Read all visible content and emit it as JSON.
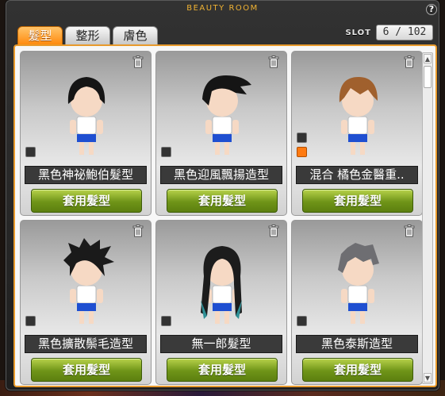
{
  "window": {
    "title": "BEAUTY ROOM",
    "help_label": "?"
  },
  "tabs": [
    {
      "label": "髮型",
      "active": true
    },
    {
      "label": "整形",
      "active": false
    },
    {
      "label": "膚色",
      "active": false
    }
  ],
  "slot": {
    "label": "SLOT",
    "value": "6 / 102"
  },
  "items": [
    {
      "name": "黑色神祕鮑伯髮型",
      "button": "套用髮型",
      "hair_color": "#151515",
      "style": "bob",
      "swatches": [
        "dark"
      ]
    },
    {
      "name": "黑色迎風飄揚造型",
      "button": "套用髮型",
      "hair_color": "#151515",
      "style": "wind",
      "swatches": [
        "dark"
      ]
    },
    {
      "name": "混合 橘色金醫重..",
      "button": "套用髮型",
      "hair_color": "#a0602d",
      "style": "mix",
      "swatches": [
        "dark",
        "orange"
      ]
    },
    {
      "name": "黑色擴散鬃毛造型",
      "button": "套用髮型",
      "hair_color": "#1a1a1a",
      "style": "spiky",
      "swatches": [
        "dark"
      ]
    },
    {
      "name": "無一郎髮型",
      "button": "套用髮型",
      "hair_color": "#1c1c1c",
      "style": "long",
      "swatches": [
        "dark"
      ]
    },
    {
      "name": "黑色泰斯造型",
      "button": "套用髮型",
      "hair_color": "#6e6e72",
      "style": "messy",
      "swatches": [
        "dark"
      ]
    }
  ],
  "colors": {
    "accent": "#e89a2c",
    "tab_active": "#ff8a0e",
    "button_green": "#6f9418"
  }
}
